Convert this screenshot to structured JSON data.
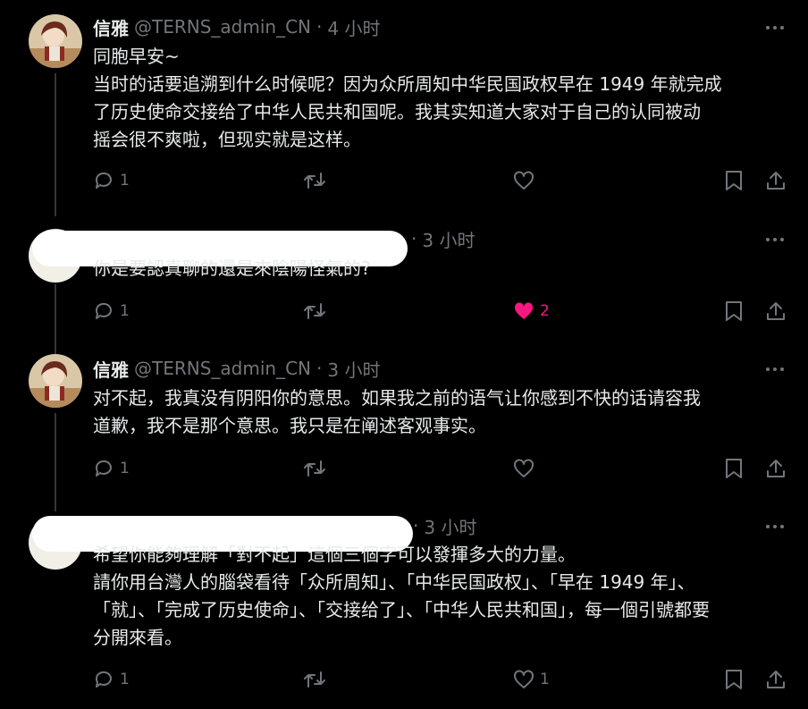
{
  "tweets": [
    {
      "author": {
        "name": "信雅",
        "handle": "@TERNS_admin_CN"
      },
      "time": "4 小时",
      "lines": [
        "同胞早安~",
        "当时的话要追溯到什么时候呢？因为众所周知中华民国政权早在 1949 年就完成",
        "了历史使命交接给了中华人民共和国呢。我其实知道大家对于自己的认同被动",
        "摇会很不爽啦，但现实就是这样。"
      ],
      "stats": {
        "replies": "1",
        "retweets": "",
        "likes": ""
      }
    },
    {
      "author": {
        "name": "",
        "handle": ""
      },
      "time": "3 小时",
      "lines": [
        "你是要認真聊的還是來陰陽怪氣的?"
      ],
      "stats": {
        "replies": "1",
        "retweets": "",
        "likes": "2"
      }
    },
    {
      "author": {
        "name": "信雅",
        "handle": "@TERNS_admin_CN"
      },
      "time": "3 小时",
      "lines": [
        "对不起，我真没有阴阳你的意思。如果我之前的语气让你感到不快的话请容我",
        "道歉，我不是那个意思。我只是在阐述客观事实。"
      ],
      "stats": {
        "replies": "1",
        "retweets": "",
        "likes": ""
      }
    },
    {
      "author": {
        "name": "",
        "handle": ""
      },
      "time": "3 小时",
      "lines": [
        "希望你能夠理解「對不起」這個三個字可以發揮多大的力量。",
        "請你用台灣人的腦袋看待「众所周知」、「中华民国政权」、「早在 1949 年」、",
        "「就」、「完成了历史使命」、「交接给了」、「中华人民共和国」，每一個引號都要",
        "分開來看。"
      ],
      "stats": {
        "replies": "1",
        "retweets": "",
        "likes": "1"
      }
    }
  ],
  "colors": {
    "background": "#000000",
    "text": "#e7e9ea",
    "muted": "#71767b",
    "like": "#f91880",
    "line": "#333639"
  }
}
